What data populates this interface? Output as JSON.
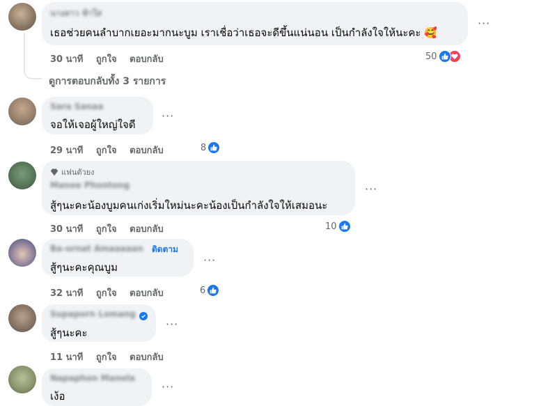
{
  "comments": [
    {
      "author": "นางสาว ฟ้าใส",
      "text": "เธอช่วยคนลำบากเยอะมากนะบูม เราเชื่อว่าเธอจะดีขึ้นแน่นอน เป็นกำลังใจให้นะคะ",
      "emoji": "🥰",
      "time": "30 นาที",
      "like_label": "ถูกใจ",
      "reply_label": "ตอบกลับ",
      "reactions": "50",
      "reaction_icons": [
        "like-icon",
        "love-icon"
      ]
    },
    {
      "author": "Sara Sanaa",
      "text": "จอให้เจอผู้ใหญ่ใจดี",
      "time": "29 นาที",
      "like_label": "ถูกใจ",
      "reply_label": "ตอบกลับ",
      "reactions": "8"
    },
    {
      "badge": "แฟนตัวยง",
      "author": "Manee Phontong",
      "text": "สู้ๆนะคะน้องบูมคนเก่งเริ่มใหม่นะคะน้องเป็นกำลังใจให้เสมอนะ",
      "time": "30 นาที",
      "like_label": "ถูกใจ",
      "reply_label": "ตอบกลับ",
      "reactions": "10"
    },
    {
      "author": "Ba-ornat Amaaaaan",
      "follow_label": "ติดตาม",
      "text": "สู้ๆนะคะคุณบูม",
      "time": "32 นาที",
      "like_label": "ถูกใจ",
      "reply_label": "ตอบกลับ",
      "reactions": "6"
    },
    {
      "author": "Supaporn Lomang",
      "verified": true,
      "text": "สู้ๆนะคะ",
      "time": "11 นาที",
      "like_label": "ถูกใจ",
      "reply_label": "ตอบกลับ"
    },
    {
      "author": "Napaphon Manola",
      "text": "เง้อ"
    }
  ],
  "view_replies": "ดูการตอบกลับทั้ง 3 รายการ",
  "more_label": "···",
  "colors": {
    "accent": "#1877f2",
    "love": "#f33e58",
    "bubble": "#f0f2f5",
    "meta": "#65676b"
  }
}
